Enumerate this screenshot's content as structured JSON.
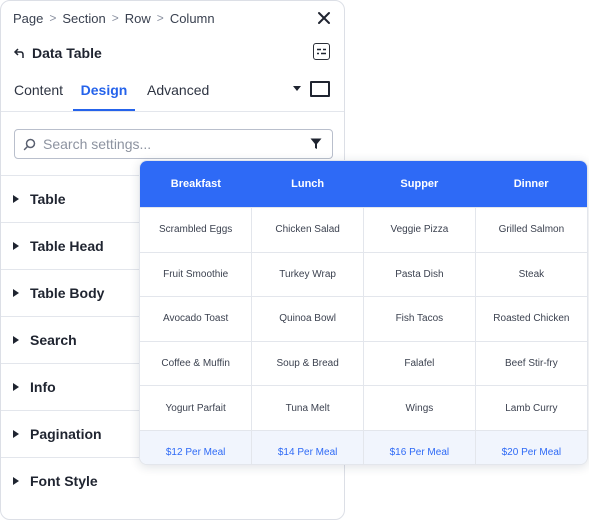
{
  "breadcrumb": [
    "Page",
    "Section",
    "Row",
    "Column"
  ],
  "panel": {
    "title": "Data Table",
    "tabs": [
      "Content",
      "Design",
      "Advanced"
    ],
    "active_tab": "Design",
    "search_placeholder": "Search settings...",
    "sections": [
      "Table",
      "Table Head",
      "Table Body",
      "Search",
      "Info",
      "Pagination",
      "Font Style"
    ]
  },
  "table": {
    "headers": [
      "Breakfast",
      "Lunch",
      "Supper",
      "Dinner"
    ],
    "rows": [
      [
        "Scrambled Eggs",
        "Chicken Salad",
        "Veggie Pizza",
        "Grilled Salmon"
      ],
      [
        "Fruit Smoothie",
        "Turkey Wrap",
        "Pasta Dish",
        "Steak"
      ],
      [
        "Avocado Toast",
        "Quinoa Bowl",
        "Fish Tacos",
        "Roasted Chicken"
      ],
      [
        "Coffee & Muffin",
        "Soup & Bread",
        "Falafel",
        "Beef Stir-fry"
      ],
      [
        "Yogurt Parfait",
        "Tuna Melt",
        "Wings",
        "Lamb Curry"
      ]
    ],
    "prices": [
      "$12 Per Meal",
      "$14 Per Meal",
      "$16 Per Meal",
      "$20 Per Meal"
    ]
  },
  "colors": {
    "accent": "#2563eb",
    "table_header": "#2e6af6",
    "price_row_bg": "#f1f5fd"
  },
  "icons": {
    "close": "close-icon",
    "back": "back-arrow-icon",
    "layout": "layout-icon",
    "dropdown": "caret-down-icon",
    "device": "desktop-icon",
    "search": "search-icon",
    "filter": "filter-icon",
    "section_toggle": "caret-right-icon"
  }
}
